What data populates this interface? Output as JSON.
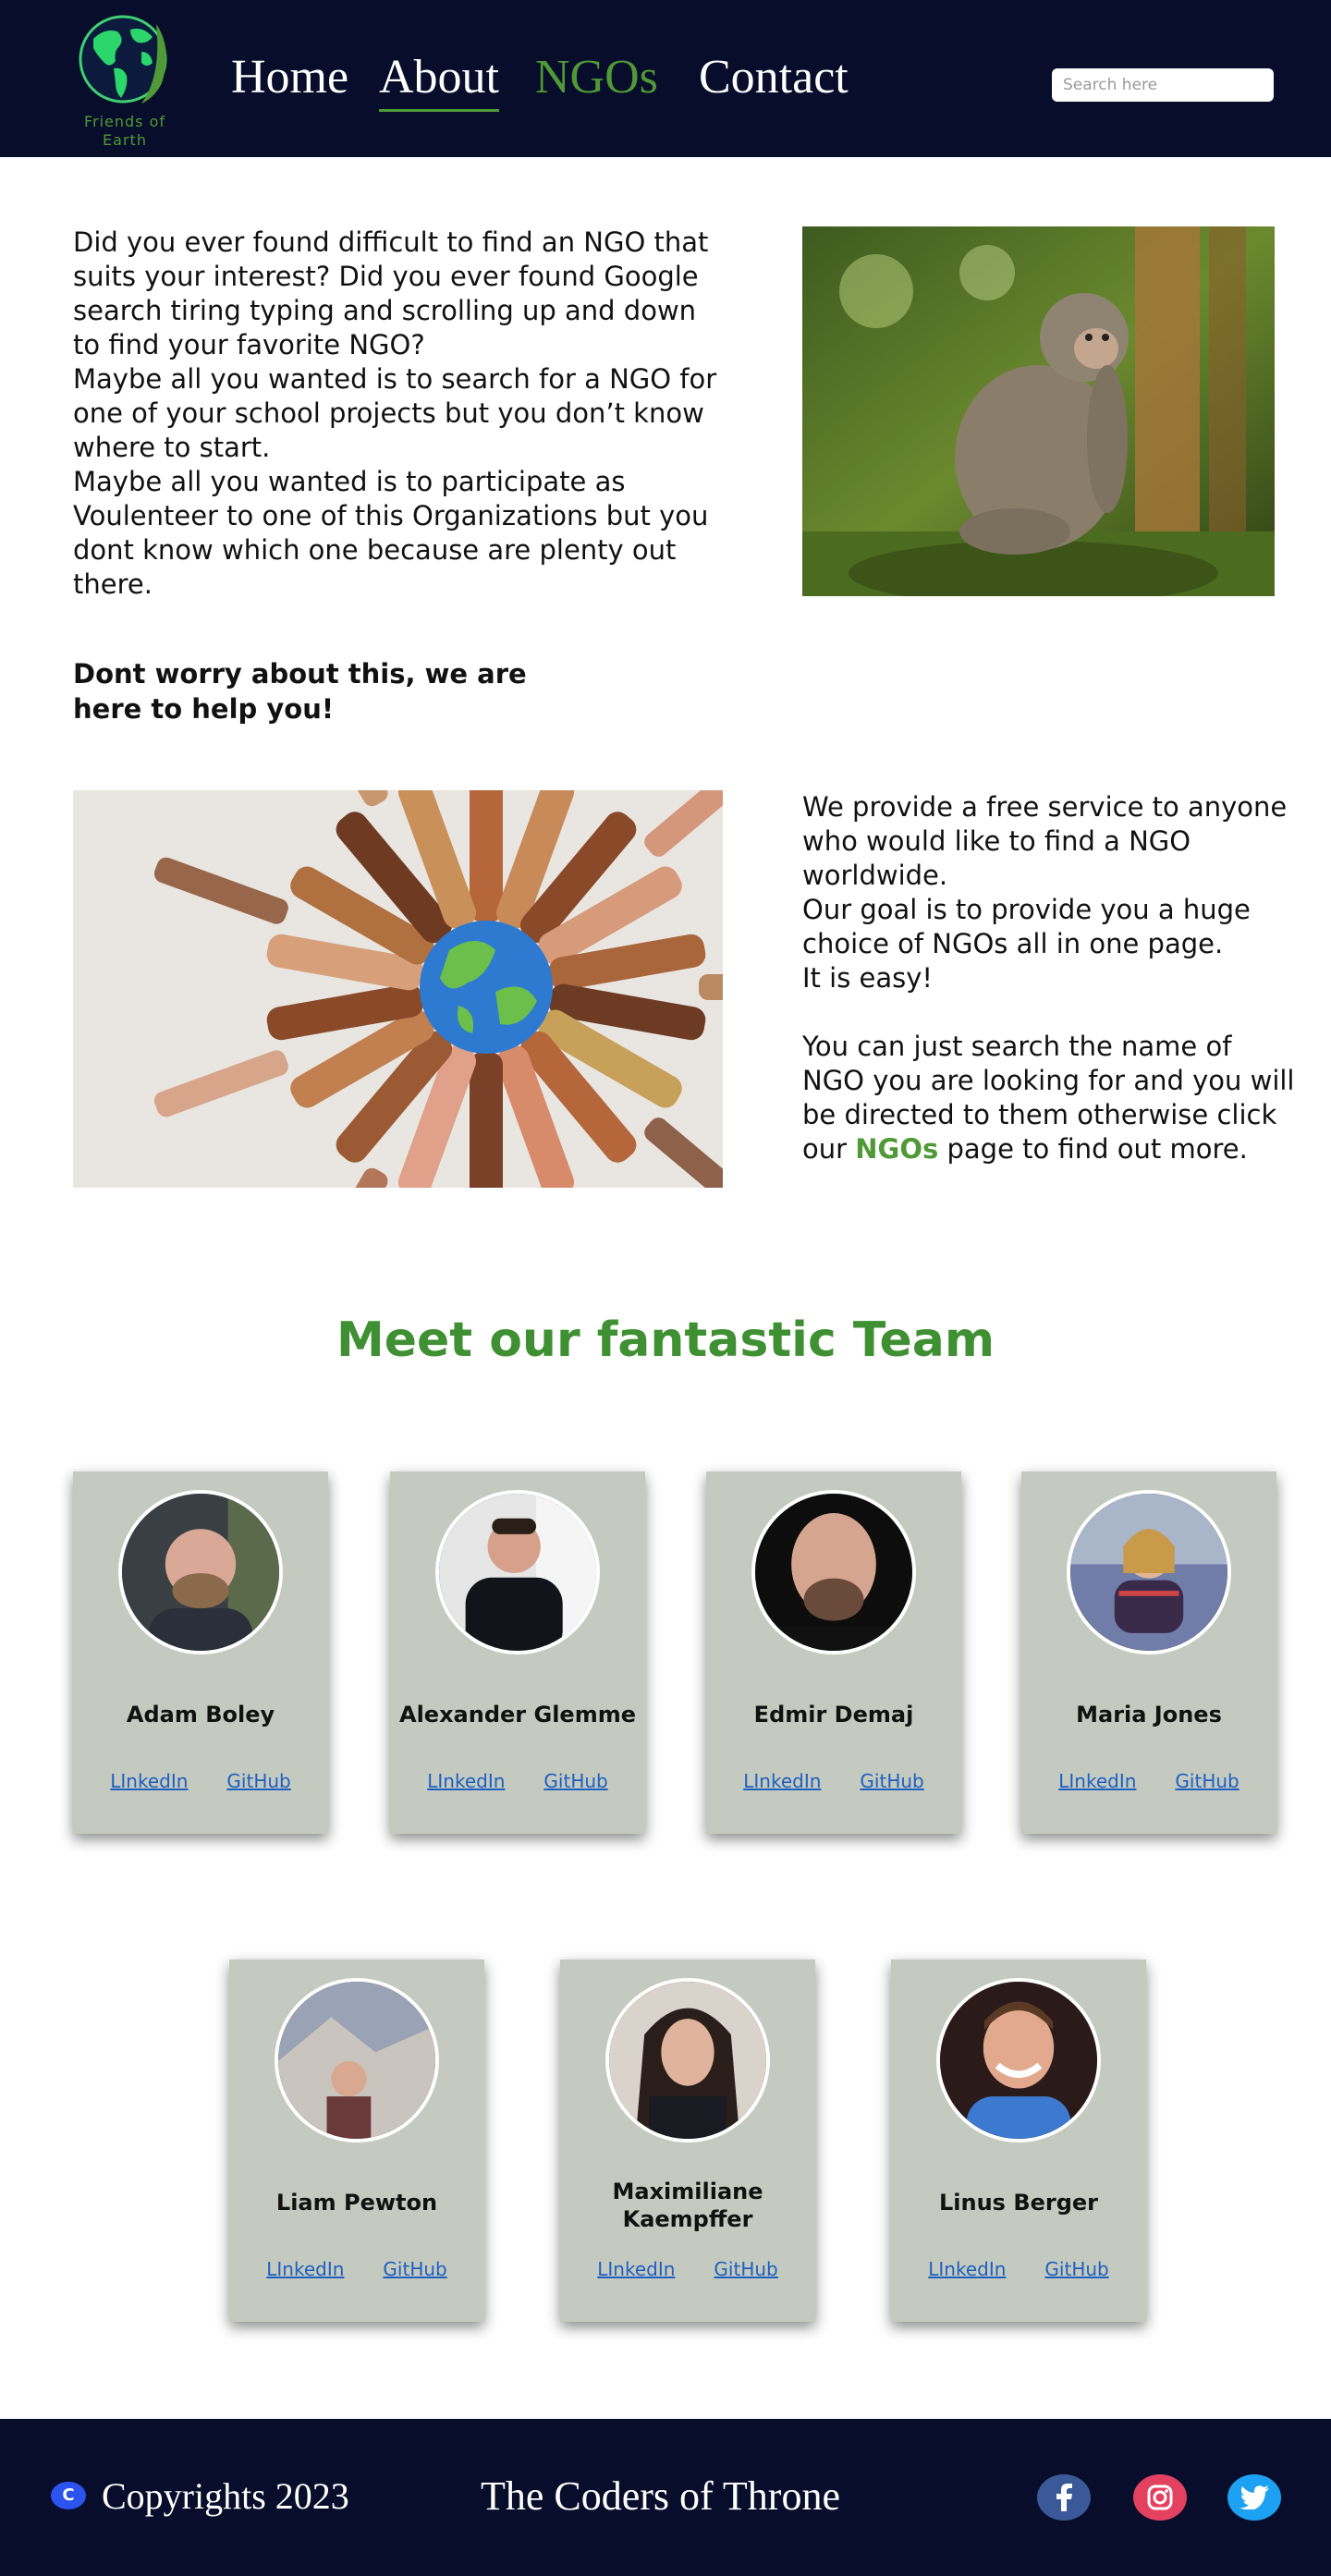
{
  "header": {
    "logo_text": "Friends of Earth",
    "nav": {
      "home": "Home",
      "about": "About",
      "ngos": "NGOs",
      "contact": "Contact"
    },
    "search_placeholder": "Search here"
  },
  "intro": {
    "paragraphs": [
      "Did you ever found difficult to find an NGO that suits your interest? Did you ever found Google search tiring typing and scrolling up and down to find your favorite NGO?",
      "Maybe all you wanted is to search for a NGO for one of your school projects but you don’t know where to start.",
      "Maybe all you wanted is to participate as Voulenteer to one of this Organizations but you dont know which one because are plenty out there."
    ],
    "bold_text": "Dont worry about this, we are here to help you!"
  },
  "service": {
    "paragraphs": [
      "We provide a free service to anyone who would like to find a NGO worldwide.",
      "Our goal is to provide you a huge choice of NGOs all in one page.",
      "It is easy!"
    ],
    "search_text_before": "You can just search the name of NGO you are looking for and you will be directed to them otherwise click our",
    "ngos_link": "NGOs",
    "search_text_after": "page to find out more."
  },
  "team": {
    "title": "Meet our fantastic Team",
    "linkedin_label": "LInkedIn",
    "github_label": "GitHub",
    "members": [
      {
        "name": "Adam Boley"
      },
      {
        "name": "Alexander Glemme"
      },
      {
        "name": "Edmir Demaj"
      },
      {
        "name": "Maria Jones"
      },
      {
        "name": "Liam Pewton"
      },
      {
        "name": "Maximiliane Kaempffer"
      },
      {
        "name": "Linus Berger"
      }
    ]
  },
  "footer": {
    "copyright_icon": "C",
    "copyright": "Copyrights 2023",
    "brand": "The Coders of Throne",
    "social_icons": [
      "facebook-icon",
      "instagram-icon",
      "twitter-icon"
    ]
  },
  "colors": {
    "navy": "#070d2a",
    "green": "#4f9a36",
    "card_bg": "#c4cac0",
    "link_blue": "#1f5fbf"
  }
}
